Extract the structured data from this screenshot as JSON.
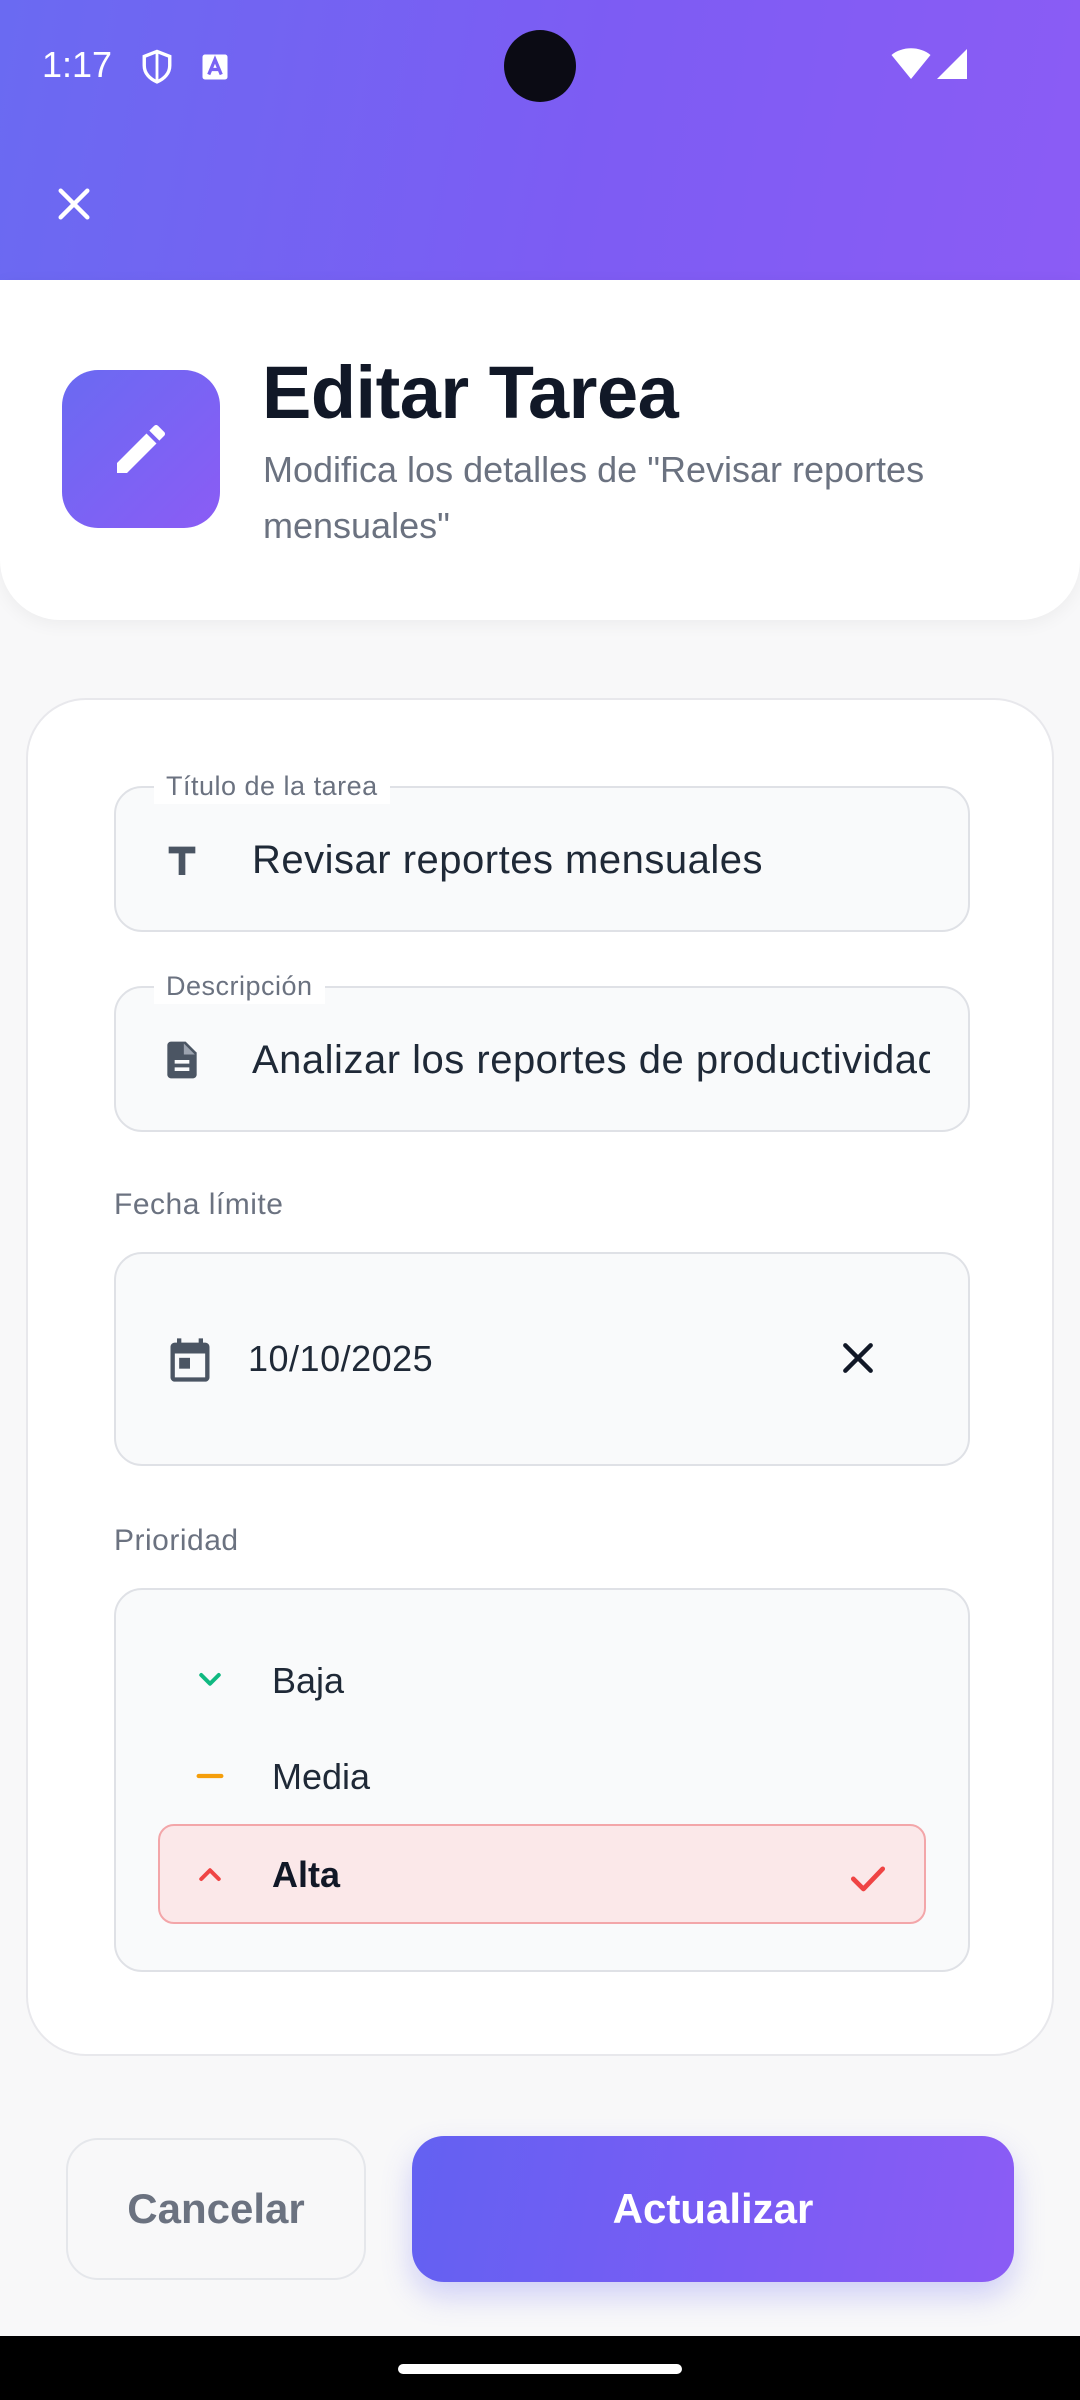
{
  "status_bar": {
    "time": "1:17",
    "icons": [
      "shield-icon",
      "keyboard-a-icon",
      "wifi-icon",
      "signal-icon"
    ]
  },
  "toolbar": {
    "close_icon": "close-icon"
  },
  "header": {
    "icon": "edit-pencil-icon",
    "title": "Editar Tarea",
    "subtitle": "Modifica los detalles de \"Revisar reportes mensuales\""
  },
  "form": {
    "title_field": {
      "label": "Título de la tarea",
      "value": "Revisar reportes mensuales",
      "icon": "text-t-icon"
    },
    "description_field": {
      "label": "Descripción",
      "value": "Analizar los reportes de productividad",
      "icon": "document-icon"
    },
    "due_date": {
      "label": "Fecha límite",
      "value": "10/10/2025",
      "icon": "calendar-icon",
      "clear_icon": "close-icon"
    },
    "priority": {
      "label": "Prioridad",
      "options": [
        {
          "label": "Baja",
          "icon": "chevron-down-icon",
          "color": "#10b981",
          "selected": false
        },
        {
          "label": "Media",
          "icon": "minus-icon",
          "color": "#f59e0b",
          "selected": false
        },
        {
          "label": "Alta",
          "icon": "chevron-up-icon",
          "color": "#ef4444",
          "selected": true
        }
      ],
      "check_icon": "check-icon"
    }
  },
  "actions": {
    "cancel_label": "Cancelar",
    "update_label": "Actualizar"
  },
  "colors": {
    "accent_start": "#6a6af2",
    "accent_end": "#8b5cf5",
    "high_priority": "#ef4444",
    "high_priority_bg": "#fbe8e9"
  }
}
